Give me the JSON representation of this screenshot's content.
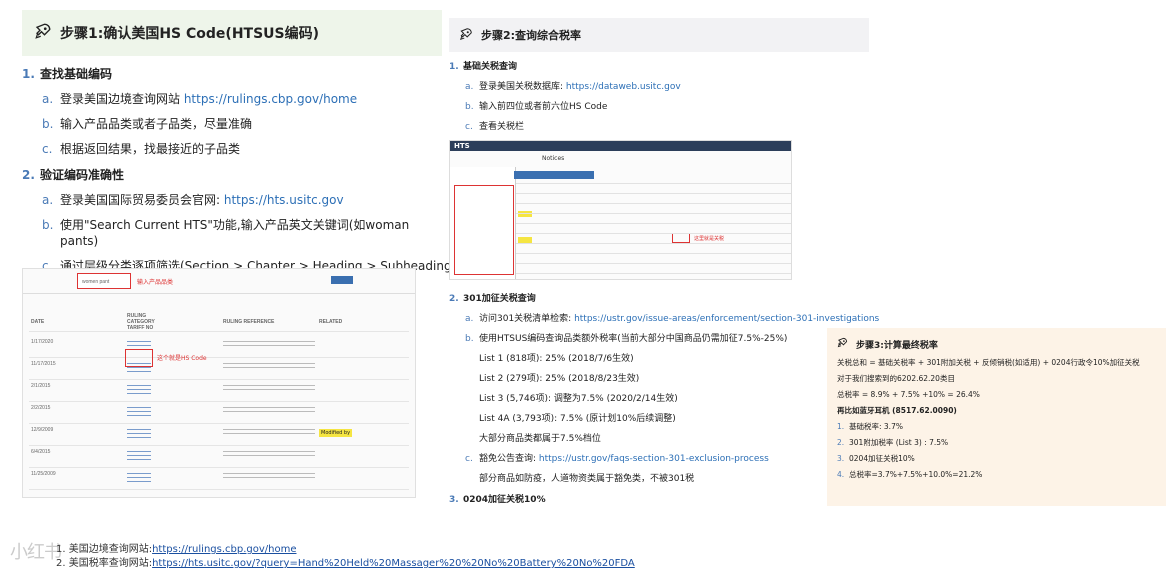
{
  "step1": {
    "title": "步骤1:确认美国HS Code(HTSUS编码)",
    "sections": [
      {
        "num": "1.",
        "title": "查找基础编码",
        "items": [
          {
            "mk": "a.",
            "text": "登录美国边境查询网站 ",
            "link": "https://rulings.cbp.gov/home"
          },
          {
            "mk": "b.",
            "text": "输入产品品类或者子品类，尽量准确",
            "link": ""
          },
          {
            "mk": "c.",
            "text": "根据返回结果，找最接近的子品类",
            "link": ""
          }
        ]
      },
      {
        "num": "2.",
        "title": "验证编码准确性",
        "items": [
          {
            "mk": "a.",
            "text": "登录美国国际贸易委员会官网: ",
            "link": "https://hts.usitc.gov"
          },
          {
            "mk": "b.",
            "text": "使用\"Search Current HTS\"功能,输入产品英文关键词(如woman pants)",
            "link": ""
          },
          {
            "mk": "c.",
            "text": "通过层级分类逐项筛选(Section > Chapter > Heading > Subheading)",
            "link": ""
          }
        ]
      }
    ],
    "screenshot": {
      "search_value": "women pant",
      "search_annotation": "输入产品品类",
      "code_annotation": "这个就是HS Code",
      "col_date": "DATE",
      "col_ruling": "RULING CATEGORY TARIFF NO",
      "col_reference": "RULING REFERENCE",
      "col_related": "RELATED",
      "modified_badge": "Modified by",
      "dates": [
        "1/17/2020",
        "11/17/2015",
        "2/1/2015",
        "2/2/2015",
        "12/9/2009",
        "6/4/2015",
        "11/25/2009"
      ]
    }
  },
  "step2": {
    "title": "步骤2:查询综合税率",
    "sections": [
      {
        "num": "1.",
        "title": "基础关税查询",
        "items": [
          {
            "mk": "a.",
            "text": "登录美国关税数据库: ",
            "link": "https://dataweb.usitc.gov"
          },
          {
            "mk": "b.",
            "text": "输入前四位或者前六位HS Code",
            "link": ""
          },
          {
            "mk": "c.",
            "text": "查看关税栏",
            "link": ""
          }
        ]
      }
    ],
    "screenshot": {
      "logo": "HTS",
      "tab": "Notices",
      "annotation": "这里就是关税"
    },
    "section301": {
      "num": "2.",
      "title": "301加征关税查询",
      "a_mk": "a.",
      "a_text": "访问301关税清单检索: ",
      "a_link": "https://ustr.gov/issue-areas/enforcement/section-301-investigations",
      "b_mk": "b.",
      "b_text": "使用HTSUS编码查询品类额外税率(当前大部分中国商品仍需加征7.5%-25%)",
      "lists": [
        "List 1 (818项): 25% (2018/7/6生效)",
        "List 2 (279项): 25% (2018/8/23生效)",
        "List 3 (5,746项): 调整为7.5% (2020/2/14生效)",
        "List 4A (3,793项): 7.5% (原计划10%后续调整)"
      ],
      "note": "大部分商品类都属于7.5%档位",
      "c_mk": "c.",
      "c_text": "豁免公告查询: ",
      "c_link": "https://ustr.gov/faqs-section-301-exclusion-process",
      "c_note": "部分商品如防疫，人道物资类属于豁免类，不被301税"
    },
    "section3": {
      "num": "3.",
      "title": "0204加征关税10%"
    }
  },
  "step3": {
    "title": "步骤3:计算最终税率",
    "formula": "关税总和 = 基础关税率 + 301附加关税 + 反倾销税(如适用) + 0204行政令10%加征关税",
    "example_intro": "对于我们搜索到的6202.62.20类目",
    "example_total": "总税率 = 8.9% + 7.5% +10% = 26.4%",
    "example2": "再比如蓝牙耳机 (8517.62.0090)",
    "items": [
      {
        "num": "1.",
        "text": "基础税率: 3.7%"
      },
      {
        "num": "2.",
        "text": "301附加税率 (List 3) : 7.5%"
      },
      {
        "num": "3.",
        "text": "0204加征关税10%"
      },
      {
        "num": "4.",
        "text": "总税率=3.7%+7.5%+10.0%=21.2%"
      }
    ]
  },
  "footer": {
    "line1_prefix": "1. 美国边境查询网站:",
    "line1_link": "https://rulings.cbp.gov/home",
    "line2_prefix": "2. 美国税率查询网站:",
    "line2_link": "https://hts.usitc.gov/?query=Hand%20Held%20Massager%20%20No%20Battery%20No%20FDA",
    "watermark": "小红书"
  },
  "colors": {
    "accent": "#4a7ab6",
    "link": "#2c6fb6",
    "step1_bg": "#eef5ea",
    "step2_bg": "#f2f2f4",
    "step3_bg": "#fdf3e7",
    "annotation_red": "#d33333"
  },
  "icons": [
    "rocket-icon"
  ]
}
